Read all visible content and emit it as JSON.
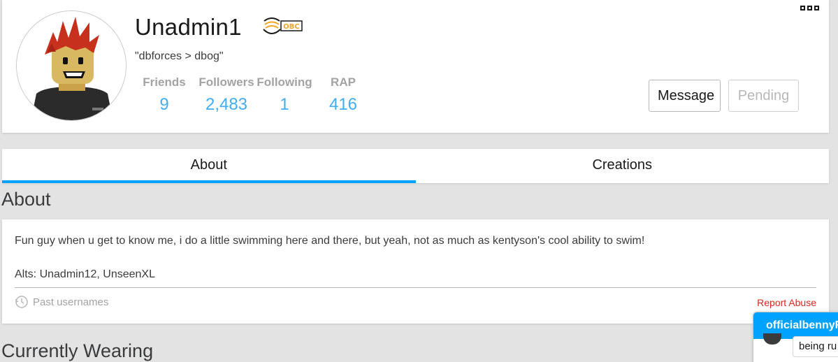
{
  "profile": {
    "username": "Unadmin1",
    "badge_text": "OBC",
    "status": "\"dbforces > dbog\"",
    "stats": [
      {
        "label": "Friends",
        "value": "9"
      },
      {
        "label": "Followers",
        "value": "2,483"
      },
      {
        "label": "Following",
        "value": "1"
      },
      {
        "label": "RAP",
        "value": "416"
      }
    ],
    "message_label": "Message",
    "pending_label": "Pending"
  },
  "tabs": [
    {
      "label": "About",
      "active": true
    },
    {
      "label": "Creations",
      "active": false
    }
  ],
  "about": {
    "title": "About",
    "description": "Fun guy when u get to know me, i do a little swimming here and there, but yeah, not as much as kentyson's cool ability to swim!",
    "alts": "Alts: Unadmin12, UnseenXL",
    "past_usernames_label": "Past usernames",
    "report_abuse_label": "Report Abuse"
  },
  "wearing": {
    "title": "Currently Wearing"
  },
  "chat": {
    "name": "officialbennyR",
    "message": "being ru"
  },
  "colors": {
    "accent": "#00a2ff",
    "stat_value": "#3faef5",
    "report": "#e2231a",
    "badge": "#f5a623"
  },
  "icons": {
    "more": "more-options-icon",
    "history": "clock-icon",
    "badge": "obc-badge-icon"
  }
}
